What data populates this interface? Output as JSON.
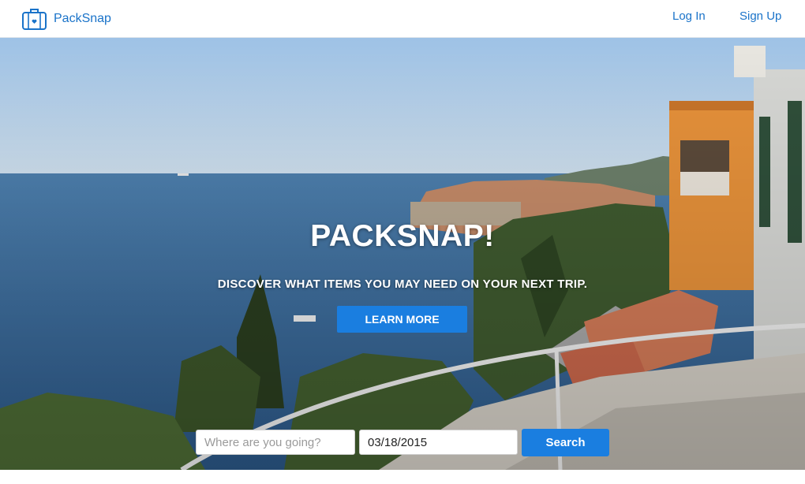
{
  "header": {
    "brand_name": "PackSnap",
    "brand_icon": "suitcase-icon",
    "login_label": "Log In",
    "signup_label": "Sign Up"
  },
  "hero": {
    "title": "PACKSNAP!",
    "subtitle": "DISCOVER WHAT ITEMS YOU MAY NEED ON YOUR NEXT TRIP.",
    "learn_more_label": "LEARN MORE"
  },
  "search": {
    "destination_placeholder": "Where are you going?",
    "destination_value": "",
    "date_value": "03/18/2015",
    "button_label": "Search"
  },
  "colors": {
    "brand": "#1a73c9",
    "accent_button": "#1a7ee0"
  }
}
